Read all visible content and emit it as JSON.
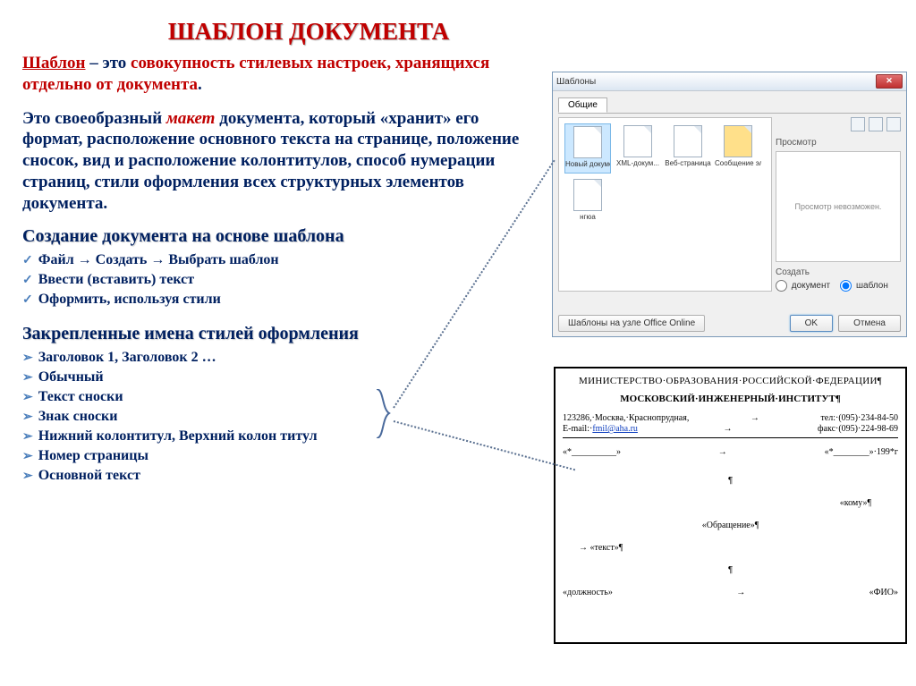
{
  "title": "ШАБЛОН ДОКУМЕНТА",
  "para1": {
    "term": "Шаблон",
    "rest1": " – это ",
    "red1": "совокупность стилевых настроек, хранящихся отдельно от документа",
    "dot": "."
  },
  "para2": {
    "p1": "Это своеобразный ",
    "maket": "макет",
    "p2": " документа, который  «хранит» его формат, расположение основного текста на странице, положение сносок, вид и расположение колонтитулов, способ нумерации страниц, стили оформления всех структурных элементов документа."
  },
  "sub1": "Создание документа на основе шаблона",
  "steps": [
    "Файл → Создать → Выбрать шаблон",
    "Ввести (вставить) текст",
    "Оформить, используя стили"
  ],
  "sub2": "Закрепленные имена стилей оформления",
  "styles": [
    "Заголовок 1, Заголовок 2 …",
    "Обычный",
    "Текст сноски",
    "Знак сноски",
    "Нижний колонтитул, Верхний колон титул",
    "Номер страницы",
    "Основной текст"
  ],
  "dialog": {
    "title": "Шаблоны",
    "tab": "Общие",
    "icons": [
      "Новый документ",
      "XML-докум...",
      "Веб-страница",
      "Сообщение электронн...",
      "нгюа"
    ],
    "previewLabel": "Просмотр",
    "previewText": "Просмотр невозможен.",
    "createLabel": "Создать",
    "radioDoc": "документ",
    "radioTpl": "шаблон",
    "onlineLink": "Шаблоны на узле Office Online",
    "ok": "OK",
    "cancel": "Отмена"
  },
  "doc": {
    "h1": "МИНИСТЕРСТВО·ОБРАЗОВАНИЯ·РОССИЙСКОЙ·ФЕДЕРАЦИИ¶",
    "h2": "МОСКОВСКИЙ·ИНЖЕНЕРНЫЙ·ИНСТИТУТ¶",
    "addr": "123286,·Москва,·Краснопрудная,",
    "tel": "тел:·(095)·234-84-50",
    "emailLabel": "E-mail:·",
    "email": "fmil@aha.ru",
    "fax": "факс·(095)·224-98-69",
    "dateLeft": "«*__________»",
    "dateRight": "«*________»·199*г",
    "komu": "«кому»¶",
    "obr": "«Обращение»¶",
    "text": "«текст»¶",
    "dolzh": "«должность»",
    "fio": "«ФИО»"
  }
}
